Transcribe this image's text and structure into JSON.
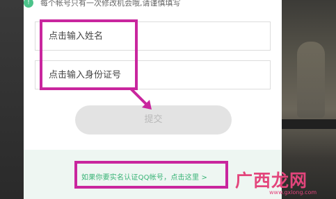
{
  "notice": {
    "icon": "info-icon",
    "text": "每个帐号只有一次修改机会哦,请谨慎填写"
  },
  "form": {
    "name_placeholder": "点击输入姓名",
    "id_placeholder": "点击输入身份证号",
    "submit_label": "提交"
  },
  "footer": {
    "link_text": "如果你要实名认证QQ帐号，点击这里 >"
  },
  "watermark": {
    "text": "广西龙网",
    "sub_text": "www.gxlong.com"
  },
  "colors": {
    "accent_green": "#37b375",
    "annotation_magenta": "#c9269e",
    "button_disabled": "#e3e3e3"
  }
}
